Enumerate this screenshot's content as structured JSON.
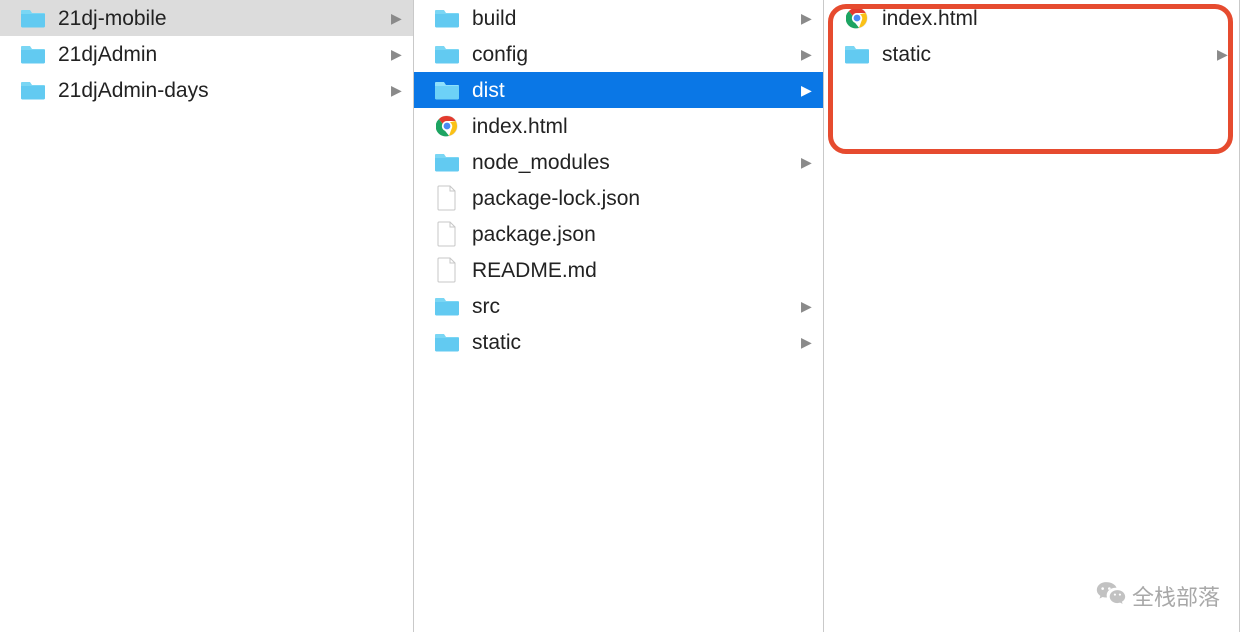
{
  "columns": {
    "col1": {
      "items": [
        {
          "name": "21dj-mobile",
          "type": "folder",
          "hasChildren": true,
          "state": "selected-path"
        },
        {
          "name": "21djAdmin",
          "type": "folder",
          "hasChildren": true,
          "state": "normal"
        },
        {
          "name": "21djAdmin-days",
          "type": "folder",
          "hasChildren": true,
          "state": "normal"
        }
      ]
    },
    "col2": {
      "items": [
        {
          "name": "build",
          "type": "folder",
          "hasChildren": true,
          "state": "normal"
        },
        {
          "name": "config",
          "type": "folder",
          "hasChildren": true,
          "state": "normal"
        },
        {
          "name": "dist",
          "type": "folder",
          "hasChildren": true,
          "state": "selected-active"
        },
        {
          "name": "index.html",
          "type": "html",
          "hasChildren": false,
          "state": "normal"
        },
        {
          "name": "node_modules",
          "type": "folder",
          "hasChildren": true,
          "state": "normal"
        },
        {
          "name": "package-lock.json",
          "type": "file",
          "hasChildren": false,
          "state": "normal"
        },
        {
          "name": "package.json",
          "type": "file",
          "hasChildren": false,
          "state": "normal"
        },
        {
          "name": "README.md",
          "type": "file",
          "hasChildren": false,
          "state": "normal"
        },
        {
          "name": "src",
          "type": "folder",
          "hasChildren": true,
          "state": "normal"
        },
        {
          "name": "static",
          "type": "folder",
          "hasChildren": true,
          "state": "normal"
        }
      ]
    },
    "col3": {
      "items": [
        {
          "name": "index.html",
          "type": "html",
          "hasChildren": false,
          "state": "normal"
        },
        {
          "name": "static",
          "type": "folder",
          "hasChildren": true,
          "state": "normal"
        }
      ]
    }
  },
  "watermark": {
    "text": "全栈部落"
  }
}
